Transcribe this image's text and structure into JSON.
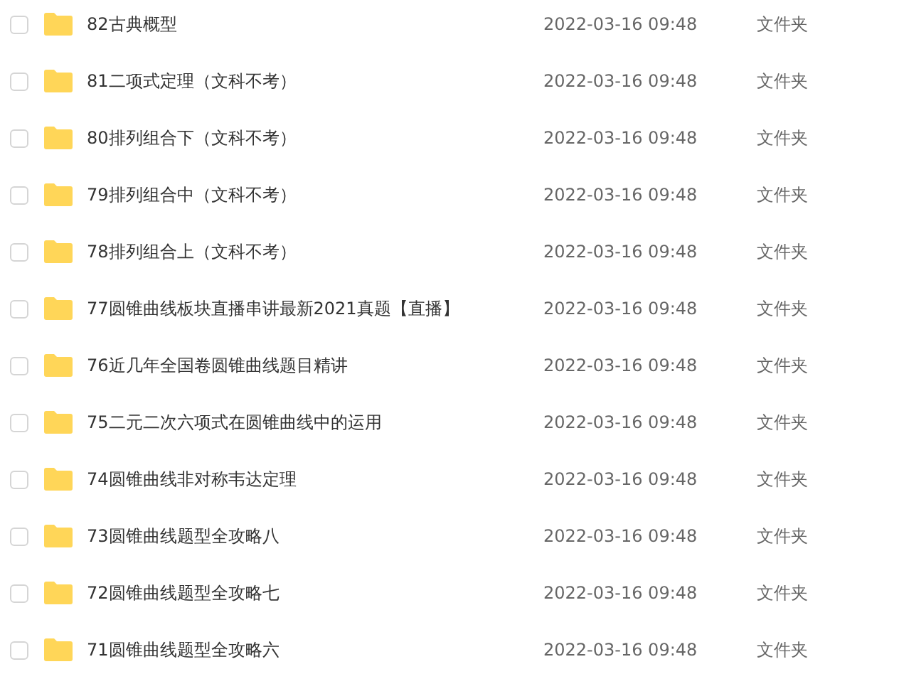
{
  "files": [
    {
      "name": "82古典概型",
      "modified": "2022-03-16 09:48",
      "type": "文件夹",
      "checked": false
    },
    {
      "name": "81二项式定理（文科不考）",
      "modified": "2022-03-16 09:48",
      "type": "文件夹",
      "checked": false
    },
    {
      "name": "80排列组合下（文科不考）",
      "modified": "2022-03-16 09:48",
      "type": "文件夹",
      "checked": false
    },
    {
      "name": "79排列组合中（文科不考）",
      "modified": "2022-03-16 09:48",
      "type": "文件夹",
      "checked": false
    },
    {
      "name": "78排列组合上（文科不考）",
      "modified": "2022-03-16 09:48",
      "type": "文件夹",
      "checked": false
    },
    {
      "name": "77圆锥曲线板块直播串讲最新2021真题【直播】",
      "modified": "2022-03-16 09:48",
      "type": "文件夹",
      "checked": false
    },
    {
      "name": "76近几年全国卷圆锥曲线题目精讲",
      "modified": "2022-03-16 09:48",
      "type": "文件夹",
      "checked": false
    },
    {
      "name": "75二元二次六项式在圆锥曲线中的运用",
      "modified": "2022-03-16 09:48",
      "type": "文件夹",
      "checked": false
    },
    {
      "name": "74圆锥曲线非对称韦达定理",
      "modified": "2022-03-16 09:48",
      "type": "文件夹",
      "checked": false
    },
    {
      "name": "73圆锥曲线题型全攻略八",
      "modified": "2022-03-16 09:48",
      "type": "文件夹",
      "checked": false
    },
    {
      "name": "72圆锥曲线题型全攻略七",
      "modified": "2022-03-16 09:48",
      "type": "文件夹",
      "checked": false
    },
    {
      "name": "71圆锥曲线题型全攻略六",
      "modified": "2022-03-16 09:48",
      "type": "文件夹",
      "checked": false
    }
  ]
}
